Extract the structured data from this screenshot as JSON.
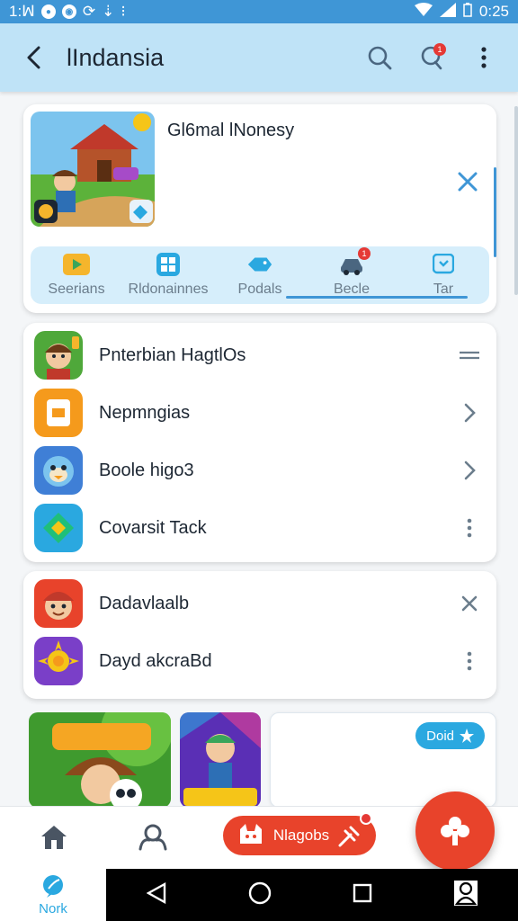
{
  "status_bar": {
    "time_left": "1:ꟽ",
    "time_right": "0:25",
    "colors": {
      "bar": "#3f96d6"
    }
  },
  "app_bar": {
    "title": "lIndansia",
    "back_icon": "arrow-left-icon",
    "search_icon": "search-icon",
    "notification_icon": "chat-bubble-icon",
    "notification_badge": "1",
    "more_icon": "more-vert-icon"
  },
  "hero": {
    "title": "Gl6mal lNonesy",
    "close_icon": "close-icon"
  },
  "tabs": [
    {
      "label": "Seerians",
      "icon": "play-icon"
    },
    {
      "label": "Rldonainnes",
      "icon": "grid-icon"
    },
    {
      "label": "Podals",
      "icon": "fish-icon"
    },
    {
      "label": "Becle",
      "icon": "car-icon",
      "badge": "1"
    },
    {
      "label": "Tar",
      "icon": "chat-square-icon"
    }
  ],
  "list": [
    {
      "label": "Pnterbian HagtlOs",
      "action": "drag-handle-icon"
    },
    {
      "label": "Nepmngias",
      "action": "chevron-right-icon"
    },
    {
      "label": "Boole higo3",
      "action": "chevron-right-icon"
    },
    {
      "label": "Covarsit Tack",
      "action": "more-vert-icon"
    }
  ],
  "list2": [
    {
      "label": "Dadavlaalb",
      "action": "close-icon"
    },
    {
      "label": "Dayd akcraBd",
      "action": "more-vert-icon"
    }
  ],
  "tiles": {
    "pill_label": "Doid"
  },
  "bottom_nav": {
    "home_icon": "home-icon",
    "people_icon": "people-icon",
    "promo_label": "Nlagobs",
    "fab_icon": "clover-icon",
    "nork_label": "Nork"
  },
  "colors": {
    "accent": "#3f96d6",
    "app_bar": "#bfe3f7",
    "fab": "#e8432b",
    "pill": "#2aa8e0"
  }
}
